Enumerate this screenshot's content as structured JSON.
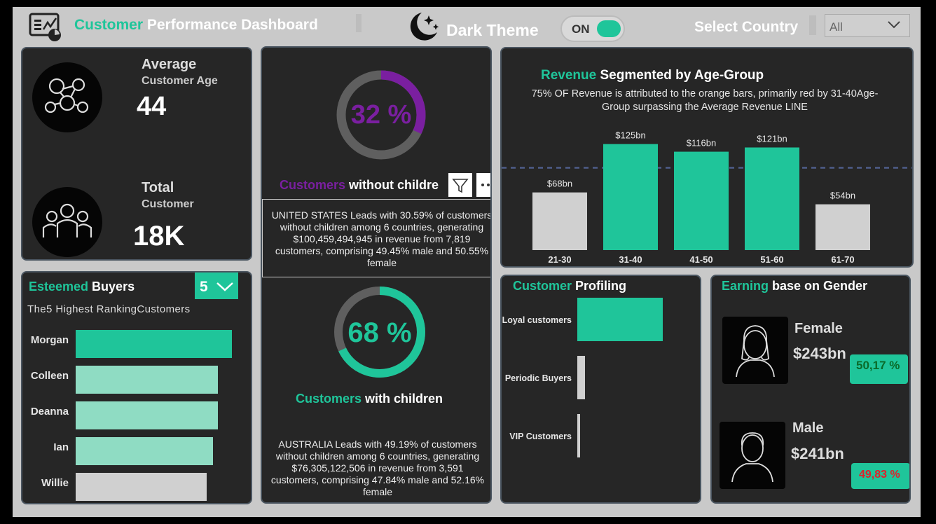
{
  "header": {
    "title_accent": "Customer",
    "title_rest": " Performance Dashboard",
    "theme_label": "Dark Theme",
    "toggle_label": "ON",
    "country_label": "Select Country",
    "country_value": "All"
  },
  "kpis": {
    "age_title": "Average",
    "age_sub": "Customer Age",
    "age_value": "44",
    "total_title": "Total",
    "total_sub": "Customer",
    "total_value": "18K"
  },
  "buyers": {
    "title_accent": "Esteemed",
    "title_rest": " Buyers",
    "subtitle": "The5 Highest RankingCustomers",
    "slicer_value": "5",
    "names": [
      "Morgan",
      "Colleen",
      "Deanna",
      "Ian",
      "Willie"
    ],
    "scores": [
      1.0,
      0.91,
      0.91,
      0.88,
      0.84
    ]
  },
  "children": {
    "without_pct": "32 %",
    "without_value": 0.32,
    "without_accent": "Customers",
    "without_rest": " without childre",
    "tooltip": "UNITED STATES Leads with 30.59% of customers without children among 6 countries, generating $100,459,494,945 in revenue from 7,819 customers, comprising 49.45% male and 50.55% female",
    "with_pct": "68 %",
    "with_value": 0.68,
    "with_accent": "Customers",
    "with_rest": " with children",
    "with_text": "AUSTRALIA Leads with 49.19% of customers without children among 6 countries, generating $76,305,122,506 in revenue from 3,591 customers, comprising 47.84% male and 52.16% female"
  },
  "chart_data": {
    "type": "bar",
    "title": "Revenue Segmented by Age-Group",
    "subtitle": "75% OF Revenue is attributed to the orange bars, primarily red by 31-40Age-Group surpassing the Average Revenue LINE",
    "categories": [
      "21-30",
      "31-40",
      "41-50",
      "51-60",
      "61-70"
    ],
    "values": [
      68,
      125,
      116,
      121,
      54
    ],
    "labels": [
      "$68bn",
      "$125bn",
      "$116bn",
      "$121bn",
      "$54bn"
    ],
    "highlight": [
      false,
      true,
      true,
      true,
      false
    ],
    "average_line": 97,
    "ylim": [
      0,
      140
    ],
    "colors": {
      "highlight": "#1fc59a",
      "normal": "#d0d0d0"
    }
  },
  "profiling": {
    "title_accent": "Customer",
    "title_rest": " Profiling",
    "categories": [
      "Loyal customers",
      "Periodic Buyers",
      "VIP Customers"
    ],
    "values": [
      1.0,
      0.09,
      0.03
    ]
  },
  "gender": {
    "title_accent": "Earning",
    "title_rest": " base on Gender",
    "female_label": "Female",
    "female_value": "$243bn",
    "female_pct": "50,17 %",
    "male_label": "Male",
    "male_value": "$241bn",
    "male_pct": "49,83 %"
  },
  "colors": {
    "accent": "#1fc59a",
    "purple": "#7a1fa0",
    "bar_light": "#8fdcc3"
  }
}
